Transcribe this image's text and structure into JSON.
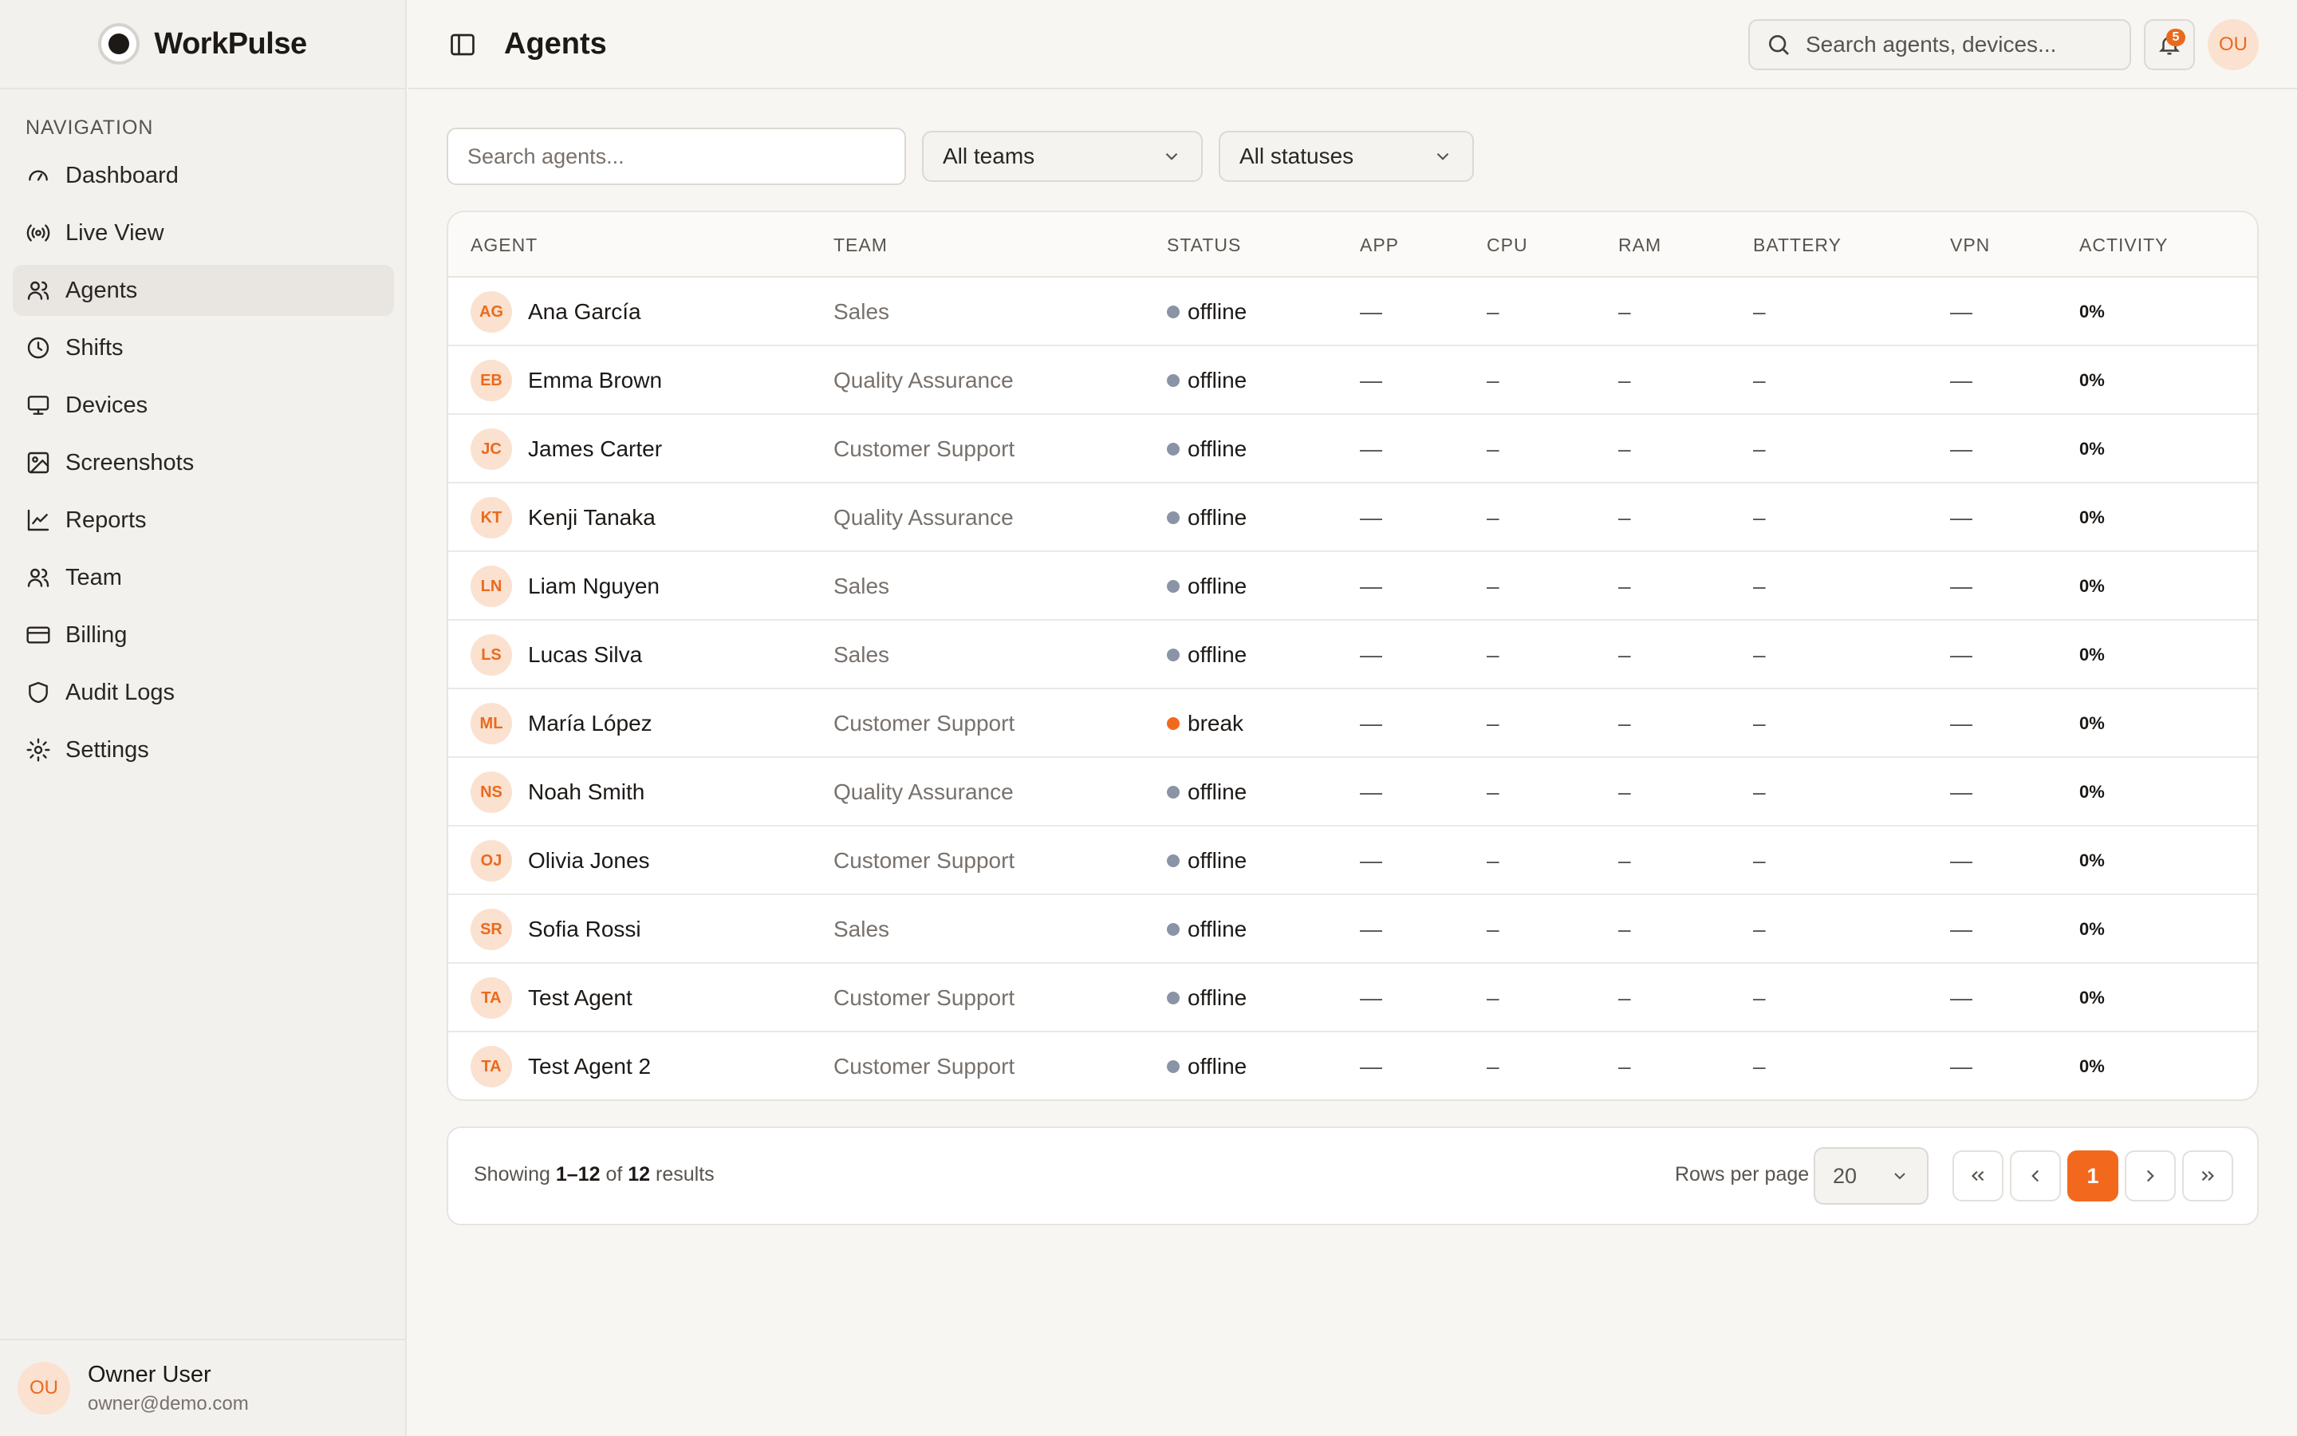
{
  "brand": {
    "name": "WorkPulse"
  },
  "sidebar": {
    "heading": "NAVIGATION",
    "items": [
      {
        "label": "Dashboard",
        "icon": "gauge-icon"
      },
      {
        "label": "Live View",
        "icon": "broadcast-icon"
      },
      {
        "label": "Agents",
        "icon": "users-icon",
        "active": true
      },
      {
        "label": "Shifts",
        "icon": "clock-icon"
      },
      {
        "label": "Devices",
        "icon": "monitor-icon"
      },
      {
        "label": "Screenshots",
        "icon": "image-icon"
      },
      {
        "label": "Reports",
        "icon": "line-chart-icon"
      },
      {
        "label": "Team",
        "icon": "users-icon"
      },
      {
        "label": "Billing",
        "icon": "credit-card-icon"
      },
      {
        "label": "Audit Logs",
        "icon": "shield-icon"
      },
      {
        "label": "Settings",
        "icon": "gear-icon"
      }
    ],
    "user": {
      "initials": "OU",
      "name": "Owner User",
      "email": "owner@demo.com"
    }
  },
  "header": {
    "title": "Agents",
    "search_placeholder": "Search agents, devices...",
    "notifications": "5",
    "avatar_initials": "OU"
  },
  "filters": {
    "search_placeholder": "Search agents...",
    "team": "All teams",
    "status": "All statuses"
  },
  "table": {
    "columns": [
      "AGENT",
      "TEAM",
      "STATUS",
      "APP",
      "CPU",
      "RAM",
      "BATTERY",
      "VPN",
      "ACTIVITY"
    ],
    "rows": [
      {
        "initials": "AG",
        "name": "Ana García",
        "team": "Sales",
        "status": "offline",
        "app": "—",
        "cpu": "–",
        "ram": "–",
        "battery": "–",
        "vpn": "—",
        "activity": "0%"
      },
      {
        "initials": "EB",
        "name": "Emma Brown",
        "team": "Quality Assurance",
        "status": "offline",
        "app": "—",
        "cpu": "–",
        "ram": "–",
        "battery": "–",
        "vpn": "—",
        "activity": "0%"
      },
      {
        "initials": "JC",
        "name": "James Carter",
        "team": "Customer Support",
        "status": "offline",
        "app": "—",
        "cpu": "–",
        "ram": "–",
        "battery": "–",
        "vpn": "—",
        "activity": "0%"
      },
      {
        "initials": "KT",
        "name": "Kenji Tanaka",
        "team": "Quality Assurance",
        "status": "offline",
        "app": "—",
        "cpu": "–",
        "ram": "–",
        "battery": "–",
        "vpn": "—",
        "activity": "0%"
      },
      {
        "initials": "LN",
        "name": "Liam Nguyen",
        "team": "Sales",
        "status": "offline",
        "app": "—",
        "cpu": "–",
        "ram": "–",
        "battery": "–",
        "vpn": "—",
        "activity": "0%"
      },
      {
        "initials": "LS",
        "name": "Lucas Silva",
        "team": "Sales",
        "status": "offline",
        "app": "—",
        "cpu": "–",
        "ram": "–",
        "battery": "–",
        "vpn": "—",
        "activity": "0%"
      },
      {
        "initials": "ML",
        "name": "María López",
        "team": "Customer Support",
        "status": "break",
        "app": "—",
        "cpu": "–",
        "ram": "–",
        "battery": "–",
        "vpn": "—",
        "activity": "0%"
      },
      {
        "initials": "NS",
        "name": "Noah Smith",
        "team": "Quality Assurance",
        "status": "offline",
        "app": "—",
        "cpu": "–",
        "ram": "–",
        "battery": "–",
        "vpn": "—",
        "activity": "0%"
      },
      {
        "initials": "OJ",
        "name": "Olivia Jones",
        "team": "Customer Support",
        "status": "offline",
        "app": "—",
        "cpu": "–",
        "ram": "–",
        "battery": "–",
        "vpn": "—",
        "activity": "0%"
      },
      {
        "initials": "SR",
        "name": "Sofia Rossi",
        "team": "Sales",
        "status": "offline",
        "app": "—",
        "cpu": "–",
        "ram": "–",
        "battery": "–",
        "vpn": "—",
        "activity": "0%"
      },
      {
        "initials": "TA",
        "name": "Test Agent",
        "team": "Customer Support",
        "status": "offline",
        "app": "—",
        "cpu": "–",
        "ram": "–",
        "battery": "–",
        "vpn": "—",
        "activity": "0%"
      },
      {
        "initials": "TA",
        "name": "Test Agent 2",
        "team": "Customer Support",
        "status": "offline",
        "app": "—",
        "cpu": "–",
        "ram": "–",
        "battery": "–",
        "vpn": "—",
        "activity": "0%"
      }
    ]
  },
  "status_colors": {
    "offline": "#8a94a6",
    "break": "#f2691e"
  },
  "pagination": {
    "showing_prefix": "Showing",
    "range": "1–12",
    "of_word": "of",
    "total": "12",
    "results_word": "results",
    "rows_per_page_label": "Rows per page",
    "rows_per_page": "20",
    "current_page": "1"
  }
}
